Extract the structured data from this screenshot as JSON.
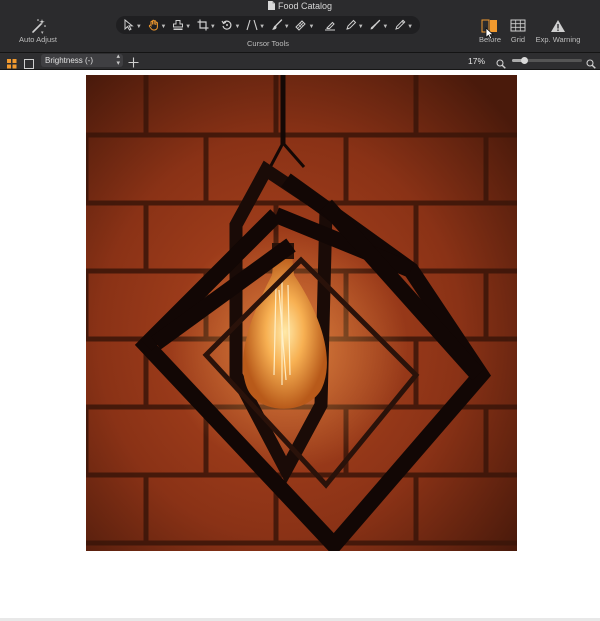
{
  "window": {
    "title": "Food Catalog"
  },
  "toolbar": {
    "auto_adjust_label": "Auto Adjust",
    "cursor_tools_label": "Cursor Tools",
    "tools": [
      {
        "name": "select-tool",
        "icon": "arrow-cursor-icon"
      },
      {
        "name": "hand-tool",
        "icon": "hand-icon",
        "active": true
      },
      {
        "name": "stamp-tool",
        "icon": "stamp-icon"
      },
      {
        "name": "crop-tool",
        "icon": "crop-icon"
      },
      {
        "name": "rotate-tool",
        "icon": "rotate-icon"
      },
      {
        "name": "perspective-tool",
        "icon": "perspective-icon"
      },
      {
        "name": "brush-tool",
        "icon": "brush-icon"
      },
      {
        "name": "gradient-tool",
        "icon": "gradient-icon"
      },
      {
        "name": "eraser-tool",
        "icon": "eraser-icon"
      },
      {
        "name": "pen-tool",
        "icon": "pen-icon"
      },
      {
        "name": "clone-tool",
        "icon": "clone-icon"
      },
      {
        "name": "retouch-tool",
        "icon": "retouch-icon"
      }
    ],
    "before_label": "Before",
    "grid_label": "Grid",
    "exp_warning_label": "Exp. Warning"
  },
  "subbar": {
    "adjustment_selected": "Brightness (-)",
    "zoom": "17%",
    "zoom_level": 0.17
  },
  "colors": {
    "accent": "#f29a2e",
    "toolbar_bg": "#2b2b2d",
    "photo_brick": "#a3401d"
  }
}
